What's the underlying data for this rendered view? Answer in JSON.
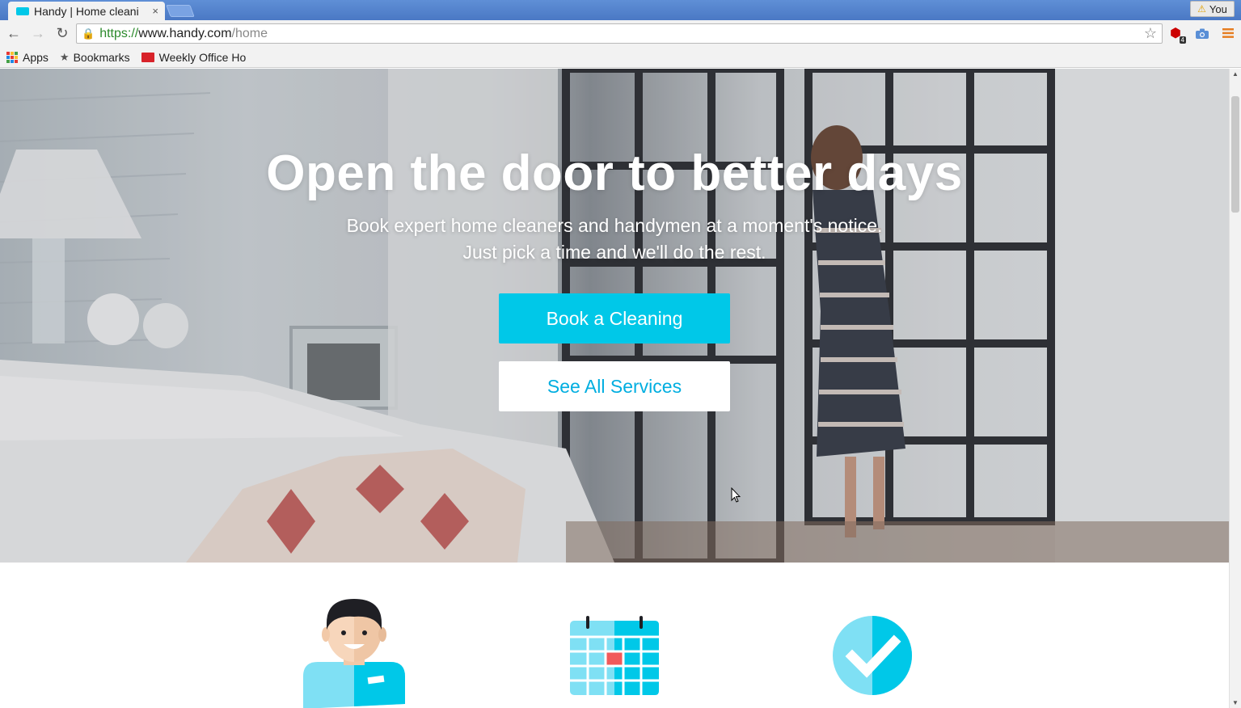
{
  "browser": {
    "tab_title": "Handy | Home cleani",
    "tab_close": "×",
    "user_label": "You",
    "url_scheme": "https://",
    "url_host": "www.handy.com",
    "url_path": "/home",
    "adblock_count": "4"
  },
  "bookmarks": {
    "apps": "Apps",
    "bookmarks": "Bookmarks",
    "weekly": "Weekly Office Ho"
  },
  "hero": {
    "title": "Open the door to better days",
    "subtitle_line1": "Book expert home cleaners and handymen at a moment's notice.",
    "subtitle_line2": "Just pick a time and we'll do the rest.",
    "primary_button": "Book a Cleaning",
    "secondary_button": "See All Services"
  },
  "colors": {
    "brand": "#00c8e8",
    "brand_dark": "#00aee0",
    "accent_red": "#f15a5a"
  },
  "features": {
    "icons": [
      "professional-icon",
      "calendar-icon",
      "checkmark-icon"
    ]
  }
}
